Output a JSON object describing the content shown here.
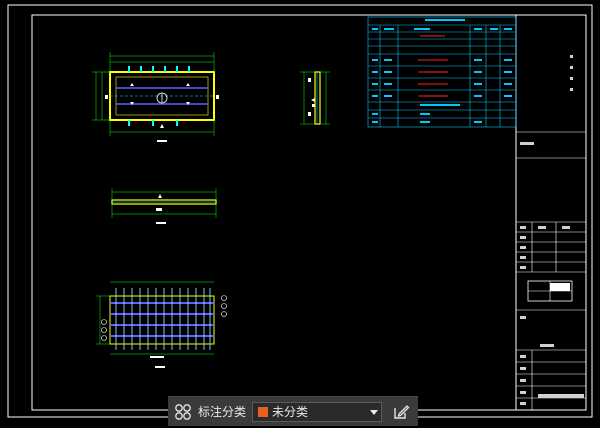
{
  "colors": {
    "accent": "#e8611f",
    "frame": "#ffffff",
    "table_line": "#00c8ff",
    "drawing_yellow": "#ffff00",
    "drawing_cyan": "#00ffff",
    "drawing_green": "#00ff00",
    "drawing_blue": "#4040ff",
    "toolbar_bg": "#3a3a3a"
  },
  "toolbar": {
    "layout_icon": "four-circles-icon",
    "label": "标注分类",
    "category_value": "未分类",
    "dropdown_icon": "caret-down-icon",
    "edit_icon": "edit-annotation-icon"
  }
}
